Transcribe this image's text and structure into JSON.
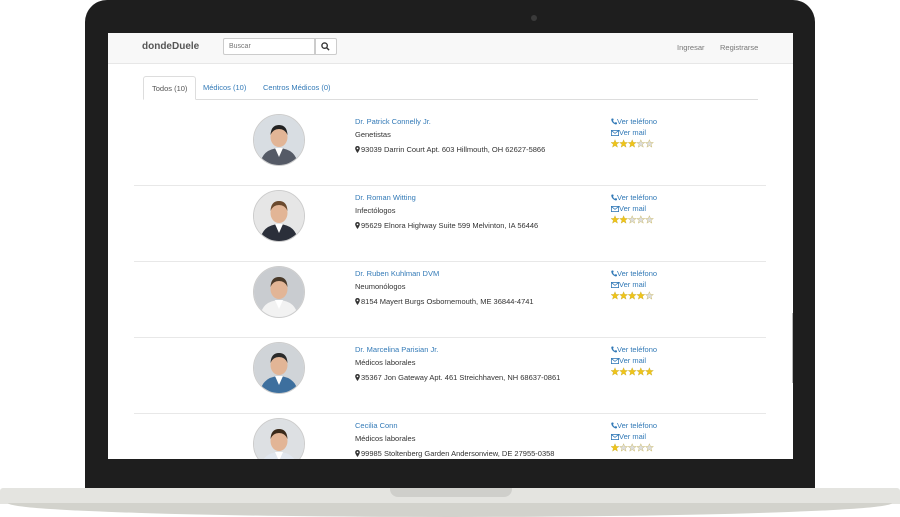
{
  "header": {
    "brand": "dondeDuele",
    "search_placeholder": "Buscar",
    "login": "Ingresar",
    "register": "Registrarse"
  },
  "tabs": [
    {
      "label": "Todos (10)",
      "active": true
    },
    {
      "label": "Médicos (10)",
      "active": false
    },
    {
      "label": "Centros Médicos (0)",
      "active": false
    }
  ],
  "doctors": [
    {
      "name": "Dr. Patrick Connelly Jr.",
      "specialty": "Genetistas",
      "address": "93039 Darrin Court Apt. 603 Hillmouth, OH 62627-5866",
      "phone_label": "Ver teléfono",
      "mail_label": "Ver mail",
      "rating": 3,
      "max_rating": 5
    },
    {
      "name": "Dr. Roman Witting",
      "specialty": "Infectólogos",
      "address": "95629 Elnora Highway Suite 599 Melvinton, IA 56446",
      "phone_label": "Ver teléfono",
      "mail_label": "Ver mail",
      "rating": 2,
      "max_rating": 5
    },
    {
      "name": "Dr. Ruben Kuhlman DVM",
      "specialty": "Neumonólogos",
      "address": "8154 Mayert Burgs Osbornemouth, ME 36844-4741",
      "phone_label": "Ver teléfono",
      "mail_label": "Ver mail",
      "rating": 4,
      "max_rating": 5
    },
    {
      "name": "Dr. Marcelina Parisian Jr.",
      "specialty": "Médicos laborales",
      "address": "35367 Jon Gateway Apt. 461 Streichhaven, NH 68637-0861",
      "phone_label": "Ver teléfono",
      "mail_label": "Ver mail",
      "rating": 5,
      "max_rating": 5
    },
    {
      "name": "Cecilia Conn",
      "specialty": "Médicos laborales",
      "address": "99985 Stoltenberg Garden Andersonview, DE 27955-0358",
      "phone_label": "Ver teléfono",
      "mail_label": "Ver mail",
      "rating": 1,
      "max_rating": 5
    }
  ],
  "colors": {
    "link": "#337ab7",
    "star_filled": "#f0c419",
    "star_empty": "#dddddd",
    "navbar_bg": "#f8f8f8"
  },
  "icons": {
    "search": "magnifier",
    "phone": "phone-icon",
    "mail": "envelope-icon",
    "location": "map-marker-icon"
  }
}
